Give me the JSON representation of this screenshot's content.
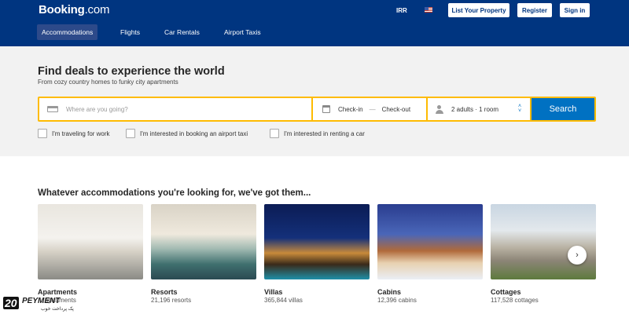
{
  "header": {
    "logo": "Booking",
    "logo_suffix": ".com",
    "currency": "IRR",
    "flag_icon": "us-flag-icon",
    "list_property": "List Your Property",
    "register": "Register",
    "signin": "Sign in",
    "brand_color": "#003580"
  },
  "nav": {
    "tabs": [
      {
        "label": "Accommodations",
        "active": true
      },
      {
        "label": "Flights",
        "active": false
      },
      {
        "label": "Car Rentals",
        "active": false
      },
      {
        "label": "Airport Taxis",
        "active": false
      }
    ]
  },
  "hero": {
    "headline": "Find deals to experience the world",
    "subline": "From cozy country homes to funky city apartments"
  },
  "search": {
    "destination_placeholder": "Where are you going?",
    "checkin": "Check-in",
    "dash": "—",
    "checkout": "Check-out",
    "guests": "2 adults · 1 room",
    "button": "Search",
    "highlight_color": "#febb02",
    "button_color": "#0071c2"
  },
  "options": {
    "work": "I'm traveling for work",
    "airport_taxi": "I'm interested in booking an airport taxi",
    "rent_car": "I'm interested in renting a car"
  },
  "accommodations": {
    "title": "Whatever accommodations you're looking for, we've got them...",
    "items": [
      {
        "name": "Apartments",
        "count": "... apartments"
      },
      {
        "name": "Resorts",
        "count": "21,196 resorts"
      },
      {
        "name": "Villas",
        "count": "365,844 villas"
      },
      {
        "name": "Cabins",
        "count": "12,396 cabins"
      },
      {
        "name": "Cottages",
        "count": "117,528 cottages"
      }
    ],
    "next_icon": "chevron-right-icon"
  },
  "watermark": {
    "number": "20",
    "text": "PEYMENT",
    "sub": "پک پرداخت خوب"
  }
}
